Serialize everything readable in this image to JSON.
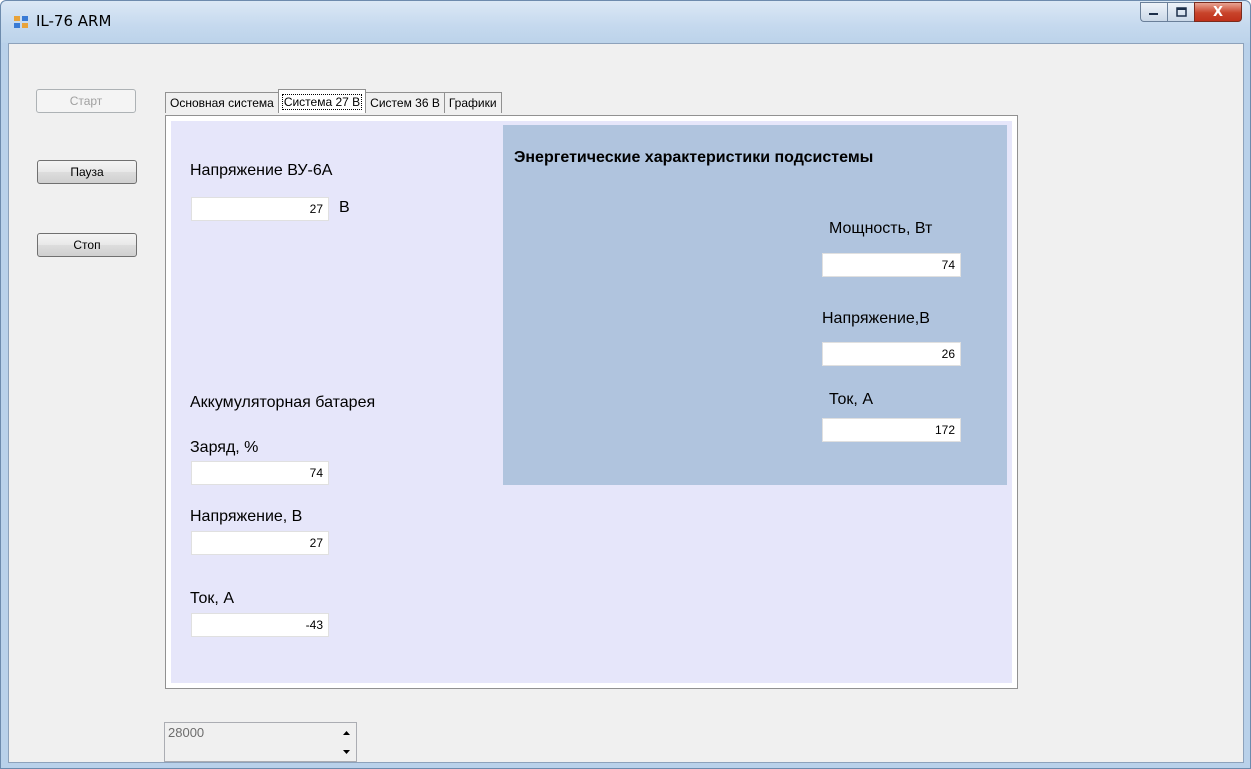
{
  "window": {
    "title": "IL-76 ARM"
  },
  "titlebar_buttons": {
    "close": "X"
  },
  "buttons": {
    "start": "Старт",
    "pause": "Пауза",
    "stop": "Стоп"
  },
  "tabs": [
    {
      "label": "Основная система",
      "active": false
    },
    {
      "label": "Система 27 В",
      "active": true
    },
    {
      "label": "Систем 36 В",
      "active": false
    },
    {
      "label": "Графики",
      "active": false
    }
  ],
  "vu6a": {
    "label": "Напряжение ВУ-6А",
    "value": "27",
    "unit": "В"
  },
  "battery": {
    "title": "Аккумуляторная батарея",
    "charge_label": "Заряд, %",
    "charge_value": "74",
    "voltage_label": "Напряжение, В",
    "voltage_value": "27",
    "current_label": "Ток, А",
    "current_value": "-43"
  },
  "energy": {
    "title": "Энергетические характеристики подсистемы",
    "power_label": "Мощность, Вт",
    "power_value": "74",
    "voltage_label": "Напряжение,В",
    "voltage_value": "26",
    "current_label": "Ток, А",
    "current_value": "172"
  },
  "numeric": {
    "value": "28000"
  },
  "colors": {
    "tabpage_bg": "#e6e6fa",
    "panel_bg": "#b0c4de",
    "window_frame": "#b9d1ea"
  }
}
